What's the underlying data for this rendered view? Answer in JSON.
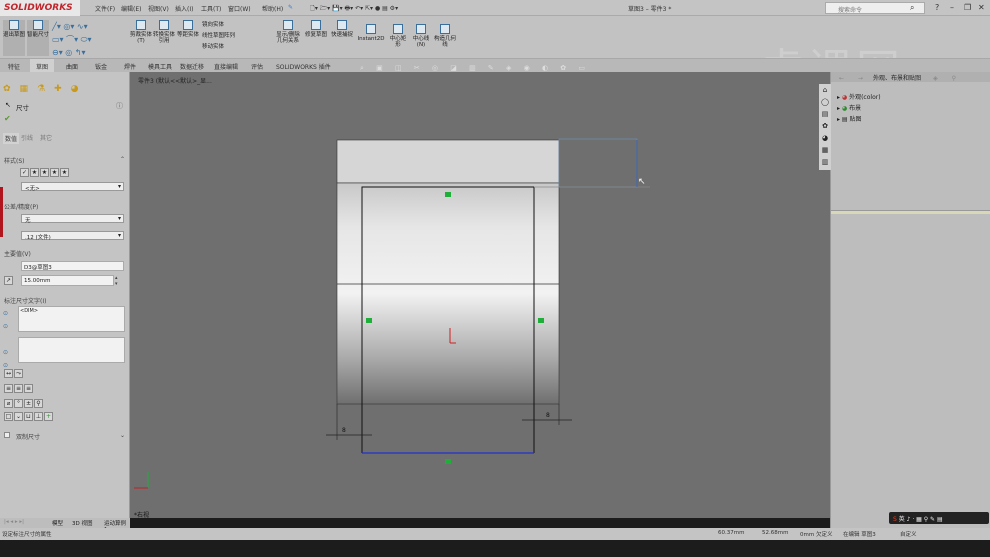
{
  "app": {
    "brand": "SOLIDWORKS",
    "title": "草图3 – 零件3 *",
    "search_placeholder": "搜索命令",
    "help": "?",
    "watermark": "虎课网"
  },
  "menu": [
    "文件(F)",
    "编辑(E)",
    "视图(V)",
    "插入(I)",
    "工具(T)",
    "窗口(W)",
    "帮助(H)"
  ],
  "ribbon": {
    "exit_sketch": "退出草图",
    "smart_dim": "智能尺寸",
    "trim": "剪裁实体(T)",
    "convert": "转换实体引用",
    "offset": "等距实体",
    "mirror": "镜向实体",
    "linear_pattern": "线性草图阵列",
    "move": "移动实体",
    "show_relations": "显示/删除几何关系",
    "repair": "修复草图",
    "quick_snap": "快速捕捉",
    "instant2d": "Instant2D",
    "center_rect": "中心矩形",
    "centerline": "中心线(N)",
    "construction": "构造几何线"
  },
  "tabs": [
    "特征",
    "草图",
    "曲面",
    "钣金",
    "焊件",
    "模具工具",
    "数据迁移",
    "直接编辑",
    "评估",
    "SOLIDWORKS 插件"
  ],
  "active_tab": "草图",
  "tree_path": "零件3 (默认<<默认>_显...",
  "property": {
    "title": "尺寸",
    "subtabs": [
      "数值",
      "引线",
      "其它"
    ],
    "style_label": "样式(S)",
    "style_value": "<无>",
    "tolerance_label": "公差/精度(P)",
    "tolerance_value": "无",
    "precision_value": ".12 (文件)",
    "primary_label": "主要值(V)",
    "primary_name": "D3@草图3",
    "primary_value": "15.00mm",
    "dim_text_label": "标注尺寸文字(I)",
    "dim_text_value": "<DIM>",
    "dual_label": "双制尺寸"
  },
  "viewport": {
    "view_label": "*右视",
    "dim_small": "8"
  },
  "taskpane": {
    "title": "外观、布景和贴图",
    "items": [
      "外观(color)",
      "布景",
      "贴图"
    ]
  },
  "bottom_tabs": [
    "模型",
    "3D 视图",
    "运动算例 1"
  ],
  "status": {
    "message": "设定标注尺寸的属性",
    "x": "60.37mm",
    "y": "52.68mm",
    "z": "0mm 欠定义",
    "state": "在编辑 草图3",
    "units": "自定义"
  }
}
